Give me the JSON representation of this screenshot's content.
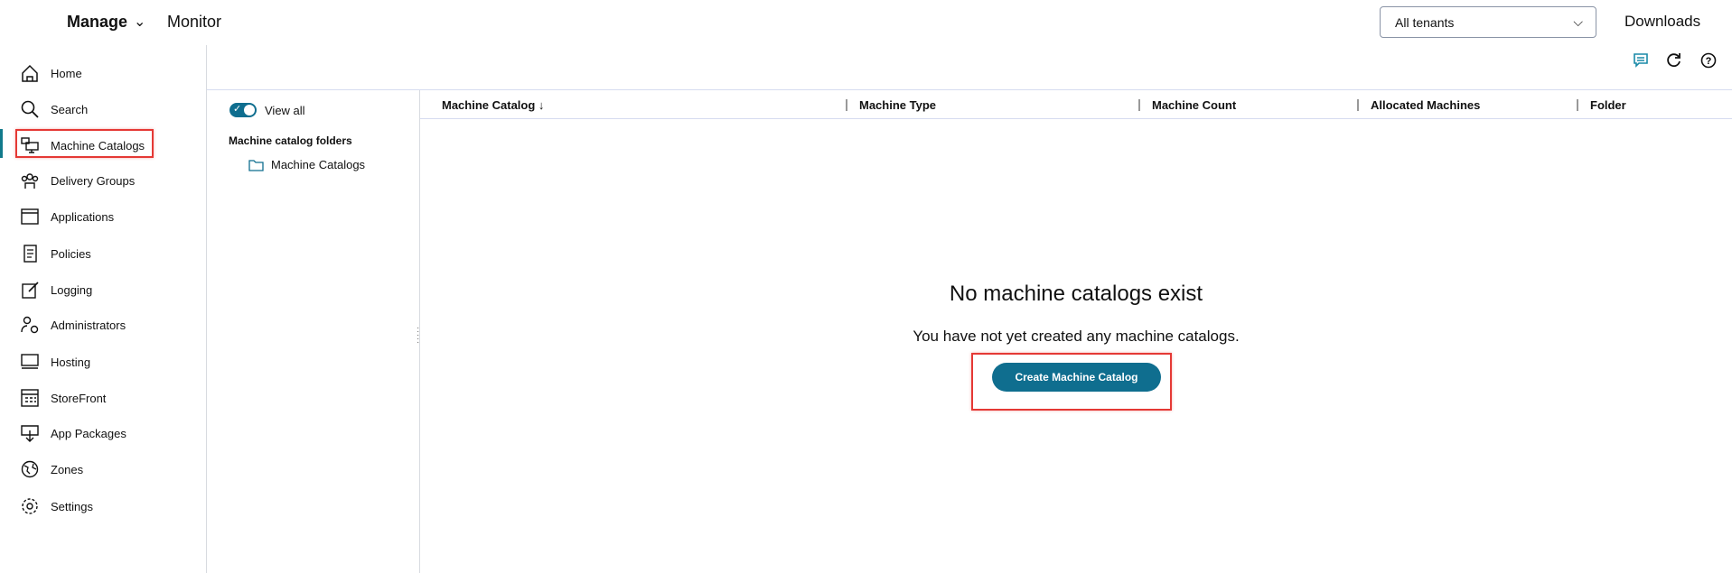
{
  "top_nav": {
    "manage": "Manage",
    "monitor": "Monitor",
    "tenant_select": "All tenants",
    "downloads": "Downloads"
  },
  "sidebar": {
    "items": [
      {
        "label": "Home"
      },
      {
        "label": "Search"
      },
      {
        "label": "Machine Catalogs"
      },
      {
        "label": "Delivery Groups"
      },
      {
        "label": "Applications"
      },
      {
        "label": "Policies"
      },
      {
        "label": "Logging"
      },
      {
        "label": "Administrators"
      },
      {
        "label": "Hosting"
      },
      {
        "label": "StoreFront"
      },
      {
        "label": "App Packages"
      },
      {
        "label": "Zones"
      },
      {
        "label": "Settings"
      }
    ],
    "active": "Machine Catalogs"
  },
  "folders": {
    "view_all": "View all",
    "heading": "Machine catalog folders",
    "items": [
      "Machine Catalogs"
    ]
  },
  "table": {
    "columns": [
      "Machine Catalog",
      "Machine Type",
      "Machine Count",
      "Allocated Machines",
      "Folder"
    ],
    "sort_indicator": "↓"
  },
  "empty": {
    "title": "No machine catalogs exist",
    "subtitle": "You have not yet created any machine catalogs.",
    "button": "Create Machine Catalog"
  },
  "colors": {
    "accent": "#0f6e8f",
    "highlight": "#e53935"
  }
}
